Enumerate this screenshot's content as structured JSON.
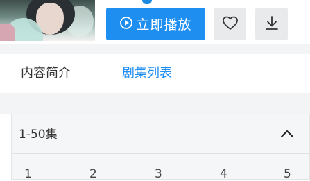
{
  "header": {
    "play_button": {
      "label": "立即播放",
      "icon": "play-circle-icon"
    },
    "favorite_button": {
      "icon": "heart-icon"
    },
    "download_button": {
      "icon": "download-icon"
    }
  },
  "tabs": [
    {
      "label": "内容简介",
      "active": false
    },
    {
      "label": "剧集列表",
      "active": true
    }
  ],
  "episode_panel": {
    "range_label": "1-50集",
    "expanded": true,
    "toggle_icon": "chevron-up-icon",
    "episodes": [
      "1",
      "2",
      "3",
      "4",
      "5"
    ]
  },
  "colors": {
    "accent": "#1f8ef1",
    "button_bg": "#e9eaeb",
    "divider": "#f3f4f5"
  }
}
